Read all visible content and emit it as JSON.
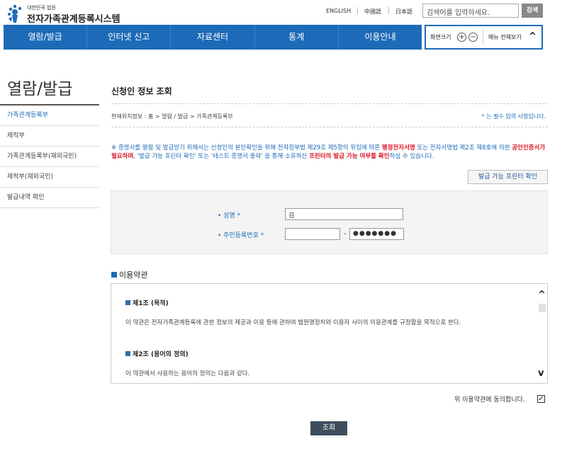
{
  "header": {
    "org_small": "대한민국 법원",
    "system_name": "전자가족관계등록시스템",
    "languages": [
      "ENGLISH",
      "中國語",
      "日本語"
    ],
    "search_placeholder": "검색어를 입력하세요.",
    "search_button": "검색"
  },
  "nav": {
    "items": [
      "열람/발급",
      "인터넷 신고",
      "자료센터",
      "통계",
      "이용안내"
    ],
    "zoom_label": "화면크기",
    "zoom_in": "+",
    "zoom_out": "−",
    "menu_all": "메뉴 전체보기"
  },
  "sidebar": {
    "title": "열람/발급",
    "items": [
      {
        "label": "가족관계등록부",
        "active": true
      },
      {
        "label": "제적부",
        "active": false
      },
      {
        "label": "가족관계등록부(재외국민)",
        "active": false
      },
      {
        "label": "제적부(재외국민)",
        "active": false
      },
      {
        "label": "발급내역 확인",
        "active": false
      }
    ]
  },
  "main": {
    "title": "신청인 정보 조회",
    "breadcrumb": "현재위치정보 : 홈 > 열람 / 발급 > 가족관계등록부",
    "required_note": "* 는 필수 입력 사항입니다.",
    "notice": {
      "p1": "※ 증명서를 열람 및 발급받기 위해서는 신청인의 본인확인을 위해 전자정부법 제29조 제5항의 위임에 따른 ",
      "r1": "행정전자서명",
      "p2": " 또는 전자서명법 제2조 제8호에 의한 ",
      "r2": "공인인증서가 필요하며",
      "p3": ", '발급 가능 프린터 확인' 또는 '테스트 증명서 출력' 을 통해 소유하신 ",
      "r3": "프린터의 발급 가능 여부를 확인",
      "p4": "하실 수 있습니다."
    },
    "printer_button": "발급 가능 프린터 확인",
    "form": {
      "name_label": "• 성명 *",
      "name_value": "김",
      "rrn_label": "• 주민등록번호 *",
      "rrn_front": "",
      "rrn_dash": "-",
      "rrn_back": "●●●●●●●"
    },
    "terms": {
      "title": "이용약관",
      "article1_heading": "제1조 (목적)",
      "article1_body": "이 약관은 전자가족관계등록에 관한 정보의 제공과 이용 등에 관하여 법원행정처와 이용자 사이의 이용관계를 규정함을 목적으로 한다.",
      "article2_heading": "제2조 (용어의 정의)",
      "article2_body": "이 약관에서 사용하는 용어의 정의는 다음과 같다."
    },
    "agree_text": "위 이용약관에 동의합니다.",
    "agree_checked": "✓",
    "submit": "조회"
  }
}
